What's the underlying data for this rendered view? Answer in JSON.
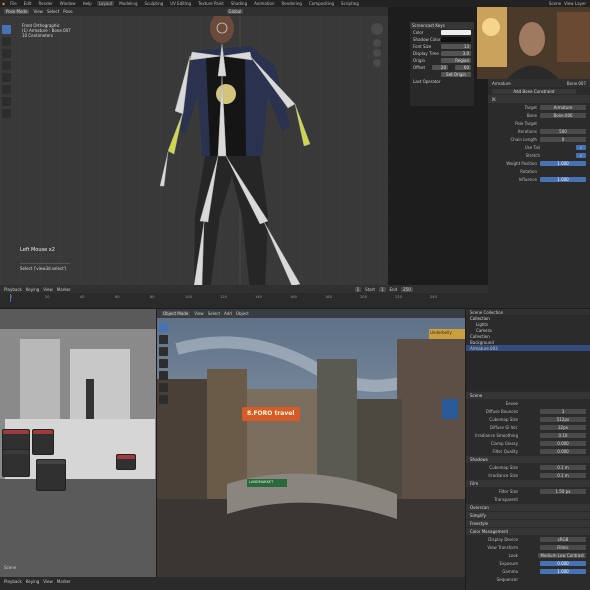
{
  "topbar": {
    "menus": [
      "File",
      "Edit",
      "Render",
      "Window",
      "Help"
    ],
    "workspaces": [
      "Layout",
      "Modeling",
      "Sculpting",
      "UV Editing",
      "Texture Paint",
      "Shading",
      "Animation",
      "Rendering",
      "Compositing",
      "Scripting"
    ],
    "active_workspace": "Layout",
    "scene": "Scene",
    "view_layer": "View Layer"
  },
  "viewport_top": {
    "mode": "Pose Mode",
    "menus": [
      "View",
      "Select",
      "Pose"
    ],
    "info_lines": [
      "Front Orthographic",
      "(1) Armature : Bone.007",
      "10 Centimeters"
    ],
    "operator_label": "Left Mouse x2",
    "operator_result": "Select ('view3d.select')",
    "shading": "Global"
  },
  "npanel": {
    "title": "Screencast Keys",
    "color_label": "Color",
    "shadow_label": "Shadow Color",
    "font_size_label": "Font Size",
    "font_size_value": "13",
    "display_time_label": "Display Time",
    "display_time_value": "3.0",
    "origin_label": "Origin",
    "origin_value": "Region",
    "offset_label": "Offset",
    "offset_x": "20",
    "offset_y": "60",
    "set_origin": "Set Origin",
    "last_operator": "Last Operator"
  },
  "timeline": {
    "menus": [
      "Playback",
      "Keying",
      "View",
      "Marker"
    ],
    "current_frame": "1",
    "start_label": "Start",
    "start": "1",
    "end_label": "End",
    "end": "250",
    "ticks": [
      "0",
      "20",
      "40",
      "60",
      "80",
      "100",
      "120",
      "140",
      "160",
      "180",
      "200",
      "220",
      "240"
    ]
  },
  "properties_top": {
    "object": "Armature",
    "bone": "Bone.007",
    "constraint": "Add Bone Constraint",
    "ik_title": "IK",
    "rows": [
      {
        "label": "Target",
        "value": "Armature"
      },
      {
        "label": "Bone",
        "value": "Bone.006"
      },
      {
        "label": "Pole Target",
        "value": ""
      },
      {
        "label": "Iterations",
        "value": "500"
      },
      {
        "label": "Chain Length",
        "value": "0"
      },
      {
        "label": "Use Tail",
        "value": "✓"
      },
      {
        "label": "Stretch",
        "value": "✓"
      },
      {
        "label": "Weight Position",
        "value": "1.000"
      },
      {
        "label": "Rotation",
        "value": ""
      },
      {
        "label": "Influence",
        "value": "1.000"
      }
    ]
  },
  "viewport_bottom": {
    "mode": "Object Mode",
    "menus": [
      "View",
      "Select",
      "Add",
      "Object"
    ],
    "sign_text": "8.FORO travel",
    "sign2": "LANDMARKET",
    "sign3": "Underbelly"
  },
  "properties_bottom": {
    "outliner_title": "Scene Collection",
    "outliner_items": [
      "Collection",
      "Lights",
      "Camera",
      "Collection",
      "Background",
      "Armature.003"
    ],
    "scene": "Scene",
    "render_info": "Eevee",
    "rows": [
      {
        "label": "Diffuse Bounces",
        "value": "3"
      },
      {
        "label": "Cubemap Size",
        "value": "512px"
      },
      {
        "label": "Diffuse GI Vol.",
        "value": "32px"
      },
      {
        "label": "Irradiance Smoothing",
        "value": "0.10"
      },
      {
        "label": "Clamp Glossy",
        "value": "0.000"
      },
      {
        "label": "Filter Quality",
        "value": "0.000"
      }
    ],
    "shadows_label": "Shadows",
    "shadow_rows": [
      {
        "label": "Cubemap Size",
        "value": "0.1 m"
      },
      {
        "label": "Irradiance Size",
        "value": "0.1 m"
      }
    ],
    "film_label": "Film",
    "film_rows": [
      {
        "label": "Filter Size",
        "value": "1.50 px"
      },
      {
        "label": "Transparent",
        "value": ""
      }
    ],
    "overscan": "Overscan",
    "simplify": "Simplify",
    "freestyle": "Freestyle",
    "color_mgmt": "Color Management",
    "cm_rows": [
      {
        "label": "Display Device",
        "value": "sRGB"
      },
      {
        "label": "View Transform",
        "value": "Filmic"
      },
      {
        "label": "Look",
        "value": "Medium Low Contrast"
      },
      {
        "label": "Exposure",
        "value": "0.000"
      },
      {
        "label": "Gamma",
        "value": "1.000"
      }
    ],
    "sequencer": "Sequencer"
  },
  "compositor": {
    "label": "Scene"
  }
}
